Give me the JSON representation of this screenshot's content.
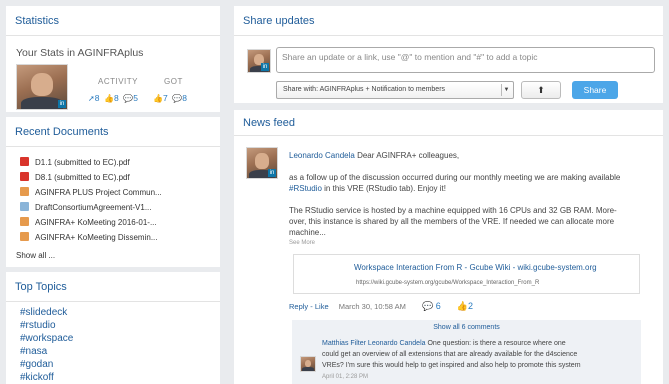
{
  "stats": {
    "title": "Statistics",
    "subtitle": "Your Stats in AGINFRAplus",
    "activity_label": "ACTIVITY",
    "got_label": "GOT",
    "activity_posts": "8",
    "activity_likes": "8",
    "activity_comments": "5",
    "got_likes": "7",
    "got_comments": "8"
  },
  "docs": {
    "title": "Recent Documents",
    "items": [
      {
        "name": "D1.1 (submitted to EC).pdf",
        "icon": "pdf-icon"
      },
      {
        "name": "D8.1 (submitted to EC).pdf",
        "icon": "pdf-icon"
      },
      {
        "name": "AGINFRA PLUS Project Commun...",
        "icon": "document-icon"
      },
      {
        "name": "DraftConsortiumAgreement-V1...",
        "icon": "image-icon"
      },
      {
        "name": "AGINFRA+ KoMeeting 2016-01-...",
        "icon": "document-icon"
      },
      {
        "name": "AGINFRA+ KoMeeting Dissemin...",
        "icon": "document-icon"
      }
    ],
    "show_all": "Show all ..."
  },
  "topics": {
    "title": "Top Topics",
    "items": [
      "#slidedeck",
      "#rstudio",
      "#workspace",
      "#nasa",
      "#godan",
      "#kickoff"
    ]
  },
  "share": {
    "title": "Share updates",
    "placeholder": "Share an update or a link, use \"@\" to mention and \"#\" to add a topic",
    "select_value": "Share with: AGINFRAplus + Notification to members",
    "share_button": "Share"
  },
  "feed": {
    "title": "News feed",
    "post": {
      "author": "Leonardo Candela",
      "greeting": "Dear AGINFRA+ colleagues,",
      "line1": "as a follow up of the discussion occurred during our monthly meeting we are making available",
      "tag": "#RStudio",
      "line2": "in this VRE (RStudio tab). Enjoy it!",
      "line3": "The RStudio service is hosted by a machine equipped with 16 CPUs and 32 GB RAM. More-",
      "line4": "over, this instance is shared by all the members of the VRE. If needed we can allocate more",
      "line5": "machine...",
      "see_more": "See More",
      "link_title": "Workspace Interaction From R - Gcube Wiki - wiki.gcube-system.org",
      "link_url": "https://wiki.gcube-system.org/gcube/Workspace_Interaction_From_R",
      "reply": "Reply",
      "like": "Like",
      "date": "March 30, 10:58 AM",
      "comment_count": "6",
      "like_count": "2"
    },
    "comments": {
      "show_all": "Show all 6 comments",
      "author": "Matthias Filter",
      "mention": "Leonardo Candela",
      "text1": "One question: is there a resource where one",
      "text2": "could get an overview of all extensions that are already available for the d4science",
      "text3": "VREs? I'm sure this would help to get inspired and also help to promote this system",
      "date": "April 01, 2:28 PM"
    }
  }
}
